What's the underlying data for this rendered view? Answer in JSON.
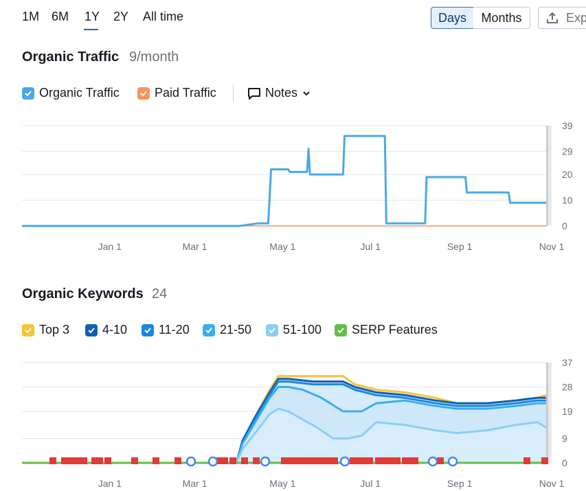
{
  "range_tabs": [
    {
      "label": "1M",
      "active": false
    },
    {
      "label": "6M",
      "active": false
    },
    {
      "label": "1Y",
      "active": true
    },
    {
      "label": "2Y",
      "active": false
    },
    {
      "label": "All time",
      "active": false
    }
  ],
  "granularity": {
    "days_label": "Days",
    "months_label": "Months",
    "selected": "Days"
  },
  "export_label": "Exp",
  "traffic_section": {
    "title": "Organic Traffic",
    "subtitle": "9/month",
    "legend": {
      "organic": "Organic Traffic",
      "paid": "Paid Traffic",
      "notes": "Notes"
    }
  },
  "keywords_section": {
    "title": "Organic Keywords",
    "subtitle": "24",
    "legend": [
      "Top 3",
      "4-10",
      "11-20",
      "21-50",
      "51-100",
      "SERP Features"
    ]
  },
  "colors": {
    "organic": "#4aa8e8",
    "paid": "#f4955a",
    "top3": "#f8c431",
    "k4_10": "#0f5fb5",
    "k11_20": "#1a88e0",
    "k21_50": "#39aeef",
    "k51_100": "#8ccdf5",
    "serp": "#62bd49",
    "flag": "#e53935"
  },
  "x_tick_labels": [
    "Jan 1",
    "Mar 1",
    "May 1",
    "Jul 1",
    "Sep 1",
    "Nov 1"
  ],
  "chart_data": [
    {
      "type": "line",
      "title": "Organic Traffic",
      "yticks": [
        0,
        10,
        20,
        29,
        39
      ],
      "ylim": [
        0,
        39
      ],
      "x_domain": [
        "Nov 1",
        "Nov 1"
      ],
      "grid": true,
      "series": [
        {
          "name": "Organic Traffic",
          "points": [
            [
              "Nov 1",
              0
            ],
            [
              "Apr 1",
              0
            ],
            [
              "Apr 14",
              1
            ],
            [
              "Apr 21",
              1
            ],
            [
              "Apr 23",
              22
            ],
            [
              "May 5",
              22
            ],
            [
              "May 6",
              21
            ],
            [
              "May 18",
              21
            ],
            [
              "May 19",
              30
            ],
            [
              "May 20",
              20
            ],
            [
              "Jun 12",
              20
            ],
            [
              "Jun 13",
              35
            ],
            [
              "Jul 11",
              35
            ],
            [
              "Jul 12",
              1
            ],
            [
              "Aug 8",
              1
            ],
            [
              "Aug 9",
              19
            ],
            [
              "Sep 5",
              19
            ],
            [
              "Sep 6",
              13
            ],
            [
              "Oct 5",
              13
            ],
            [
              "Oct 6",
              9
            ],
            [
              "Oct 31",
              9
            ]
          ]
        },
        {
          "name": "Paid Traffic",
          "points": [
            [
              "Nov 1",
              0
            ],
            [
              "Oct 31",
              0
            ]
          ]
        }
      ]
    },
    {
      "type": "area",
      "title": "Organic Keywords",
      "yticks": [
        0,
        9,
        19,
        28,
        37
      ],
      "ylim": [
        0,
        37
      ],
      "grid": true,
      "series": [
        {
          "name": "Top 3",
          "points": [
            [
              "Mar 30",
              0
            ],
            [
              "Apr 3",
              8
            ],
            [
              "Apr 12",
              17
            ],
            [
              "Apr 22",
              27
            ],
            [
              "Apr 28",
              32
            ],
            [
              "May 5",
              32
            ],
            [
              "May 22",
              32
            ],
            [
              "Jun 12",
              32
            ],
            [
              "Jun 20",
              29
            ],
            [
              "Jul 5",
              27
            ],
            [
              "Jul 25",
              26
            ],
            [
              "Aug 15",
              24
            ],
            [
              "Aug 30",
              22
            ],
            [
              "Sep 20",
              22
            ],
            [
              "Oct 10",
              23
            ],
            [
              "Oct 25",
              24
            ],
            [
              "Oct 31",
              25
            ]
          ]
        },
        {
          "name": "4-10",
          "points": [
            [
              "Mar 30",
              0
            ],
            [
              "Apr 3",
              8
            ],
            [
              "Apr 12",
              17
            ],
            [
              "Apr 22",
              26
            ],
            [
              "Apr 28",
              31
            ],
            [
              "May 5",
              31
            ],
            [
              "May 22",
              30
            ],
            [
              "Jun 12",
              30
            ],
            [
              "Jun 20",
              28
            ],
            [
              "Jul 5",
              26
            ],
            [
              "Jul 25",
              25
            ],
            [
              "Aug 15",
              23
            ],
            [
              "Aug 30",
              22
            ],
            [
              "Sep 20",
              22
            ],
            [
              "Oct 10",
              23
            ],
            [
              "Oct 25",
              24
            ],
            [
              "Oct 31",
              24
            ]
          ]
        },
        {
          "name": "11-20",
          "points": [
            [
              "Mar 30",
              0
            ],
            [
              "Apr 3",
              7
            ],
            [
              "Apr 12",
              16
            ],
            [
              "Apr 22",
              25
            ],
            [
              "Apr 28",
              30
            ],
            [
              "May 5",
              30
            ],
            [
              "May 22",
              29
            ],
            [
              "Jun 12",
              29
            ],
            [
              "Jun 20",
              27
            ],
            [
              "Jul 5",
              25
            ],
            [
              "Jul 25",
              24
            ],
            [
              "Aug 15",
              22
            ],
            [
              "Aug 30",
              21
            ],
            [
              "Sep 20",
              21
            ],
            [
              "Oct 10",
              22
            ],
            [
              "Oct 25",
              23
            ],
            [
              "Oct 31",
              23
            ]
          ]
        },
        {
          "name": "21-50",
          "points": [
            [
              "Mar 30",
              0
            ],
            [
              "Apr 3",
              7
            ],
            [
              "Apr 12",
              15
            ],
            [
              "Apr 22",
              24
            ],
            [
              "Apr 28",
              28
            ],
            [
              "May 5",
              28
            ],
            [
              "May 15",
              27
            ],
            [
              "May 28",
              24
            ],
            [
              "Jun 12",
              19
            ],
            [
              "Jun 25",
              19
            ],
            [
              "Jul 5",
              22
            ],
            [
              "Jul 25",
              23
            ],
            [
              "Aug 15",
              21
            ],
            [
              "Aug 30",
              20
            ],
            [
              "Sep 20",
              20
            ],
            [
              "Oct 10",
              21
            ],
            [
              "Oct 25",
              22
            ],
            [
              "Oct 31",
              22
            ]
          ]
        },
        {
          "name": "51-100",
          "points": [
            [
              "Mar 30",
              0
            ],
            [
              "Apr 3",
              5
            ],
            [
              "Apr 12",
              11
            ],
            [
              "Apr 22",
              18
            ],
            [
              "Apr 28",
              20
            ],
            [
              "May 5",
              19
            ],
            [
              "May 15",
              16
            ],
            [
              "May 25",
              13
            ],
            [
              "Jun 5",
              9
            ],
            [
              "Jun 15",
              9
            ],
            [
              "Jun 25",
              10
            ],
            [
              "Jul 5",
              15
            ],
            [
              "Jul 25",
              14
            ],
            [
              "Aug 15",
              12
            ],
            [
              "Aug 30",
              11
            ],
            [
              "Sep 20",
              12
            ],
            [
              "Oct 10",
              14
            ],
            [
              "Oct 25",
              15
            ],
            [
              "Oct 31",
              13
            ]
          ]
        },
        {
          "name": "SERP Features",
          "points": [
            [
              "Nov 1",
              0
            ],
            [
              "Oct 31",
              0
            ]
          ]
        }
      ]
    }
  ]
}
